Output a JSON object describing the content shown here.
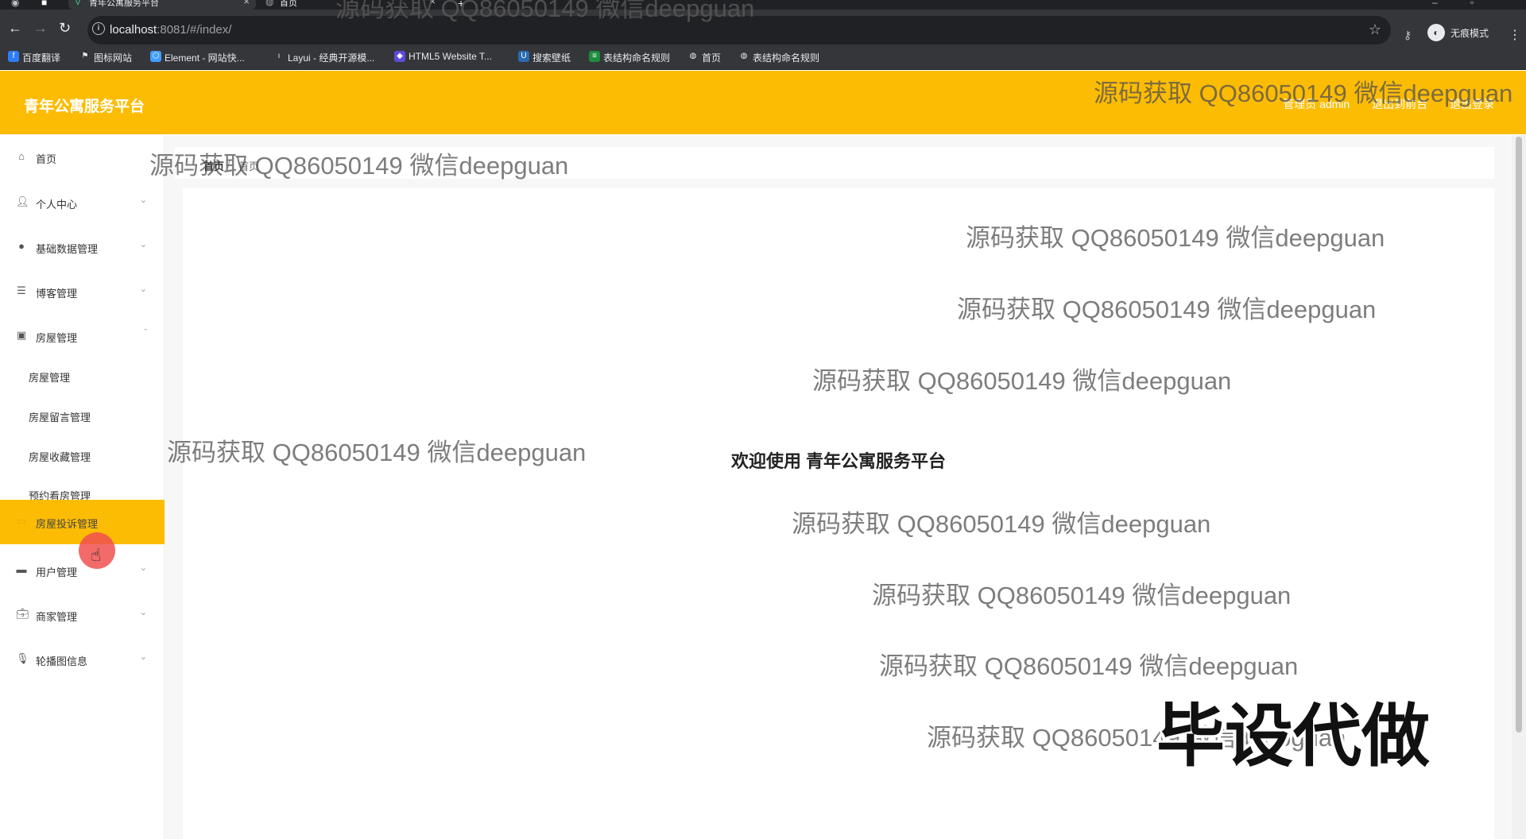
{
  "browser": {
    "tabs": [
      {
        "label": "青年公寓服务平台",
        "active": true
      },
      {
        "label": "首页",
        "active": false
      }
    ],
    "new_tab": "+",
    "url_host": "localhost",
    "url_rest": ":8081/#/index/",
    "incognito_label": "无痕模式",
    "bookmarks": [
      {
        "label": "百度翻译",
        "icon": "translate-icon",
        "color": "#2f7cf6"
      },
      {
        "label": "图标网站",
        "icon": "flag-icon",
        "color": "#35363a"
      },
      {
        "label": "Element - 网站快...",
        "icon": "element-icon",
        "color": "#409eff"
      },
      {
        "label": "Layui - 经典开源模...",
        "icon": "layui-icon",
        "color": "#35363a"
      },
      {
        "label": "HTML5 Website T...",
        "icon": "shield-icon",
        "color": "#5b4cdb"
      },
      {
        "label": "搜索壁纸",
        "icon": "wallpaper-icon",
        "color": "#2b6cb0"
      },
      {
        "label": "表结构命名规则",
        "icon": "sheet-icon",
        "color": "#1e8e3e"
      },
      {
        "label": "首页",
        "icon": "globe-icon",
        "color": "#35363a"
      },
      {
        "label": "表结构命名规则",
        "icon": "globe-icon",
        "color": "#35363a"
      }
    ]
  },
  "header": {
    "title": "青年公寓服务平台",
    "admin": "管理员 admin",
    "back_to_front": "退出到前台",
    "logout": "退出登录"
  },
  "sidebar": {
    "items": [
      {
        "label": "首页",
        "icon": "home-icon",
        "has_children": false
      },
      {
        "label": "个人中心",
        "icon": "user-icon",
        "has_children": true
      },
      {
        "label": "基础数据管理",
        "icon": "leaf-icon",
        "has_children": true
      },
      {
        "label": "博客管理",
        "icon": "list-icon",
        "has_children": true
      },
      {
        "label": "房屋管理",
        "icon": "building-icon",
        "has_children": true,
        "expanded": true
      }
    ],
    "sub_items": [
      "房屋管理",
      "房屋留言管理",
      "房屋收藏管理",
      "预约看房管理"
    ],
    "active_item": {
      "label": "房屋投诉管理",
      "icon": "complaint-icon"
    },
    "items_after": [
      {
        "label": "用户管理",
        "icon": "users-icon",
        "has_children": true
      },
      {
        "label": "商家管理",
        "icon": "briefcase-icon",
        "has_children": true
      },
      {
        "label": "轮播图信息",
        "icon": "mic-icon",
        "has_children": true
      }
    ]
  },
  "breadcrumb": {
    "home": "首页",
    "separator": "/",
    "current": "首页"
  },
  "main": {
    "welcome": "欢迎使用 青年公寓服务平台"
  },
  "watermark": {
    "text": "源码获取 QQ86050149 微信deepguan",
    "stamp": "毕设代做"
  },
  "colors": {
    "accent": "#fdbc04",
    "chrome_dark": "#35363a"
  }
}
